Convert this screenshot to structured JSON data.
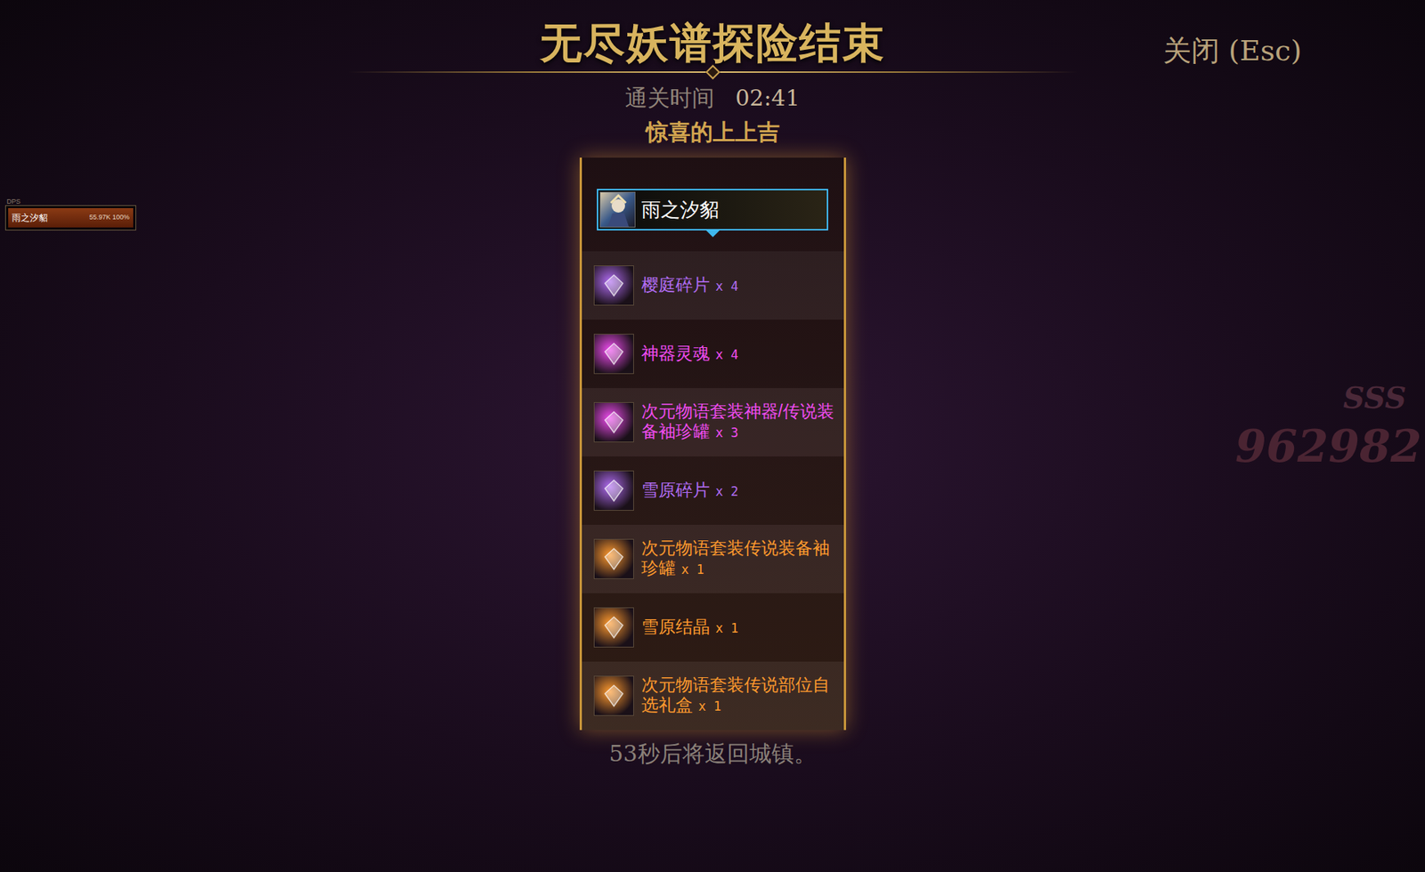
{
  "dialog": {
    "title": "无尽妖谱探险结束",
    "close": "关闭 (Esc)",
    "clear_time_label": "通关时间",
    "clear_time": "02:41",
    "rating": "惊喜的上上吉",
    "player": {
      "name": "雨之汐貂",
      "selected": true
    },
    "items": [
      {
        "name": "樱庭碎片",
        "count": "x 4",
        "color": "#b06cf2"
      },
      {
        "name": "神器灵魂",
        "count": "x 4",
        "color": "#f04cf0"
      },
      {
        "name": "次元物语套装神器/传说装备袖珍罐",
        "count": "x 3",
        "color": "#f04cf0"
      },
      {
        "name": "雪原碎片",
        "count": "x 2",
        "color": "#b06cf2"
      },
      {
        "name": "次元物语套装传说装备袖珍罐",
        "count": "x 1",
        "color": "#ff9a2e"
      },
      {
        "name": "雪原结晶",
        "count": "x 1",
        "color": "#ff9a2e"
      },
      {
        "name": "次元物语套装传说部位自选礼盒",
        "count": "x 1",
        "color": "#ff9a2e"
      }
    ],
    "countdown": "53秒后将返回城镇。"
  },
  "dps_meter": {
    "label": "DPS",
    "name": "雨之汐貂",
    "reading": "55.97K 100%",
    "level": 1
  },
  "background_text": [
    "SSS",
    "962982"
  ]
}
